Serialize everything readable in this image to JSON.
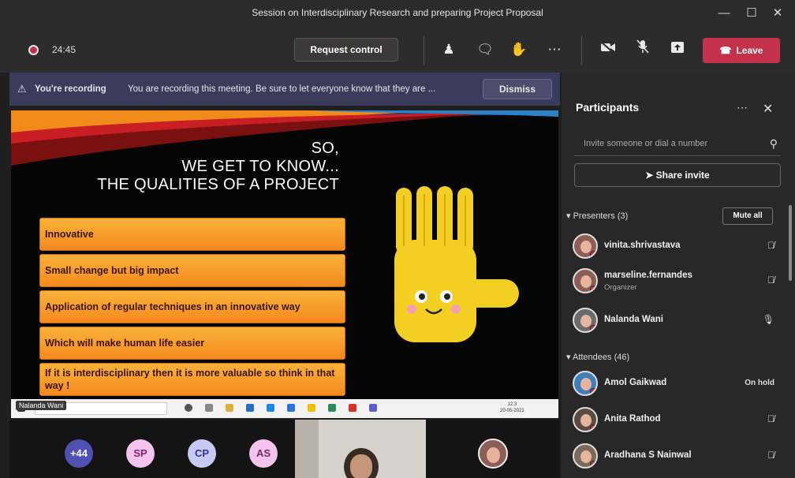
{
  "window": {
    "title": "Session on Interdisciplinary Research and preparing Project Proposal"
  },
  "toolbar": {
    "timer": "24:45",
    "request_control_label": "Request control",
    "leave_label": "Leave"
  },
  "banner": {
    "title": "You're recording",
    "text": "You are recording this meeting. Be sure to let everyone know that they are ...",
    "dismiss_label": "Dismiss"
  },
  "slide": {
    "title_lines": [
      "SO,",
      "WE GET TO KNOW...",
      "THE QUALITIES OF A PROJECT"
    ],
    "qualities": [
      "Innovative",
      "Small change but big impact",
      "Application of regular techniques in an innovative way",
      "Which will make human life easier",
      "If it is interdisciplinary then it is more valuable so think in that way !"
    ],
    "taskbar_clock": [
      "12:3",
      "20-05-2021"
    ]
  },
  "presenter_tag": "Nalanda Wani",
  "bottom": {
    "avatars": [
      {
        "text": "+44",
        "bg": "#4f52b2",
        "fg": "#ffffff"
      },
      {
        "text": "SP",
        "bg": "#f4c4ec",
        "fg": "#7a2a6a"
      },
      {
        "text": "CP",
        "bg": "#c7c9f5",
        "fg": "#33358a"
      },
      {
        "text": "AS",
        "bg": "#f4c4ec",
        "fg": "#7a2a6a"
      }
    ]
  },
  "participants": {
    "title": "Participants",
    "invite_placeholder": "Invite someone or dial a number",
    "share_invite_label": "Share invite",
    "presenters_header": "Presenters (3)",
    "mute_all_label": "Mute all",
    "attendees_header": "Attendees (46)",
    "presenters": [
      {
        "name": "vinita.shrivastava",
        "role": "",
        "status_icon": "mic-off-icon"
      },
      {
        "name": "marseline.fernandes",
        "role": "Organizer",
        "status_icon": "mic-off-icon"
      },
      {
        "name": "Nalanda Wani",
        "role": "",
        "status_icon": "mic-on-icon"
      }
    ],
    "attendees": [
      {
        "name": "Amol Gaikwad",
        "status_text": "On hold"
      },
      {
        "name": "Anita Rathod",
        "status_icon": "mic-off-icon"
      },
      {
        "name": "Aradhana S Nainwal",
        "status_icon": "mic-off-icon"
      }
    ]
  },
  "colors": {
    "leave": "#c4314b",
    "banner": "#3b3c5c",
    "slide_box": "#f5891f",
    "hand": "#f3cf24"
  }
}
